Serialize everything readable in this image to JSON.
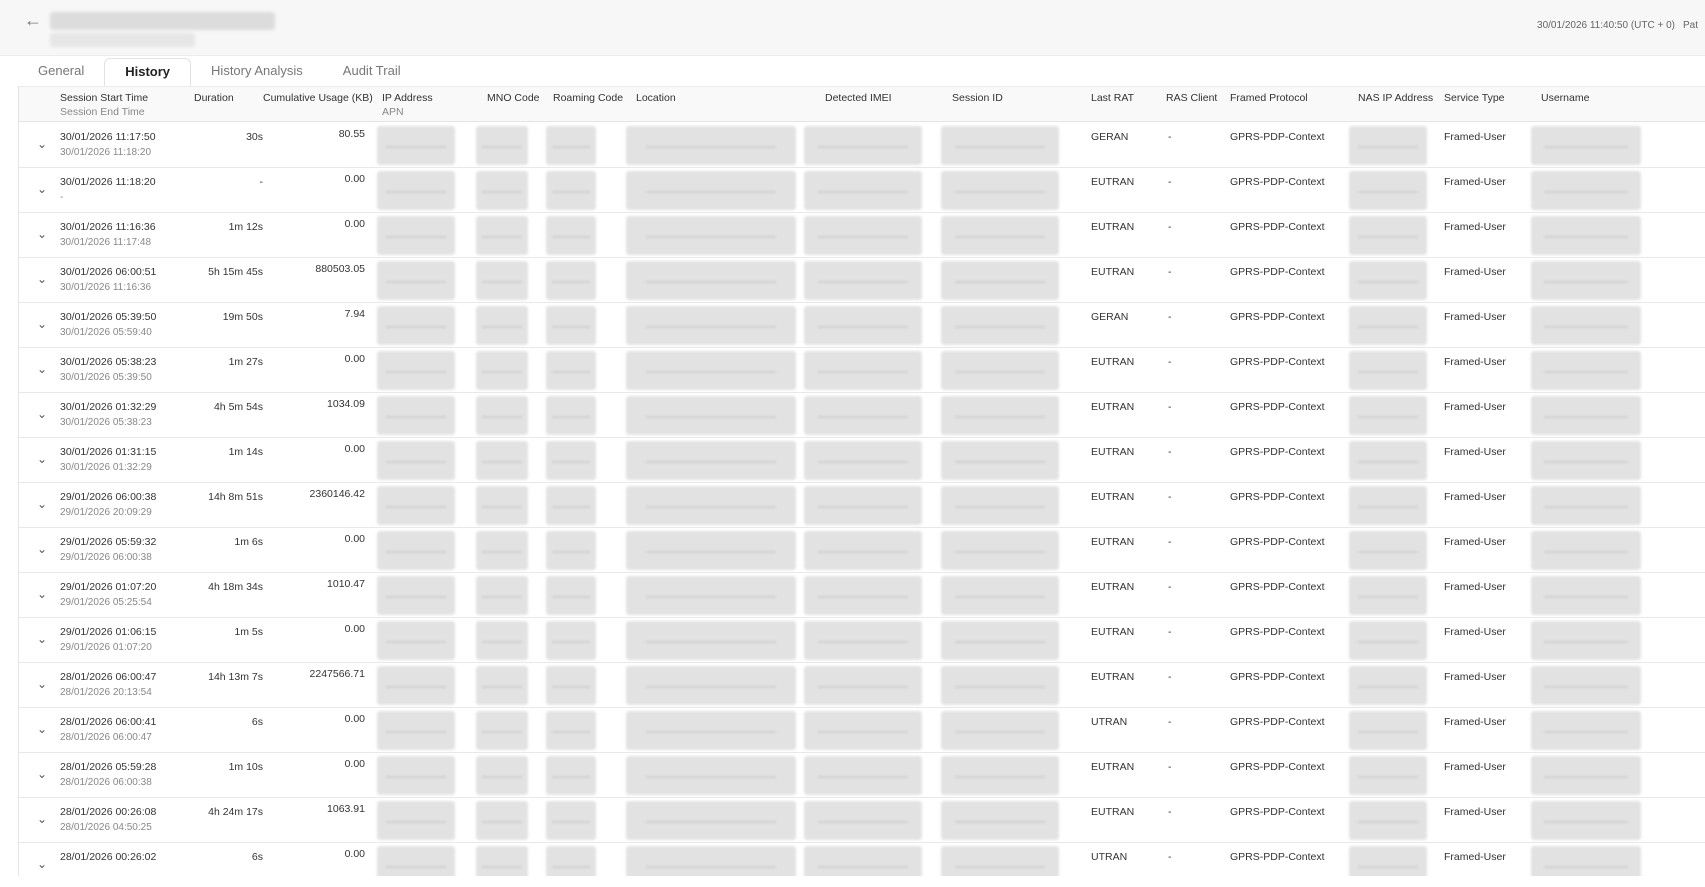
{
  "header": {
    "back_icon": "arrow-left-icon",
    "timestamp": "30/01/2026 11:40:50 (UTC + 0)",
    "timestamp_tail": "Pat"
  },
  "tabs": [
    {
      "label": "General",
      "active": false
    },
    {
      "label": "History",
      "active": true
    },
    {
      "label": "History Analysis",
      "active": false
    },
    {
      "label": "Audit Trail",
      "active": false
    }
  ],
  "columns": {
    "session_start": "Session Start Time",
    "session_end": "Session End Time",
    "duration": "Duration",
    "usage": "Cumulative Usage (KB)",
    "ip": "IP Address",
    "apn": "APN",
    "mno": "MNO Code",
    "roaming": "Roaming Code",
    "location": "Location",
    "imei": "Detected IMEI",
    "session_id": "Session ID",
    "last_rat": "Last RAT",
    "ras_client": "RAS Client",
    "framed_protocol": "Framed Protocol",
    "nas_ip": "NAS IP Address",
    "service_type": "Service Type",
    "username": "Username"
  },
  "rows": [
    {
      "start": "30/01/2026 11:17:50",
      "end": "30/01/2026 11:18:20",
      "duration": "30s",
      "usage": "80.55",
      "rat": "GERAN",
      "ras": "-",
      "protocol": "GPRS-PDP-Context",
      "service": "Framed-User"
    },
    {
      "start": "30/01/2026 11:18:20",
      "end": "-",
      "duration": "-",
      "usage": "0.00",
      "rat": "EUTRAN",
      "ras": "-",
      "protocol": "GPRS-PDP-Context",
      "service": "Framed-User"
    },
    {
      "start": "30/01/2026 11:16:36",
      "end": "30/01/2026 11:17:48",
      "duration": "1m 12s",
      "usage": "0.00",
      "rat": "EUTRAN",
      "ras": "-",
      "protocol": "GPRS-PDP-Context",
      "service": "Framed-User"
    },
    {
      "start": "30/01/2026 06:00:51",
      "end": "30/01/2026 11:16:36",
      "duration": "5h 15m 45s",
      "usage": "880503.05",
      "rat": "EUTRAN",
      "ras": "-",
      "protocol": "GPRS-PDP-Context",
      "service": "Framed-User"
    },
    {
      "start": "30/01/2026 05:39:50",
      "end": "30/01/2026 05:59:40",
      "duration": "19m 50s",
      "usage": "7.94",
      "rat": "GERAN",
      "ras": "-",
      "protocol": "GPRS-PDP-Context",
      "service": "Framed-User"
    },
    {
      "start": "30/01/2026 05:38:23",
      "end": "30/01/2026 05:39:50",
      "duration": "1m 27s",
      "usage": "0.00",
      "rat": "EUTRAN",
      "ras": "-",
      "protocol": "GPRS-PDP-Context",
      "service": "Framed-User"
    },
    {
      "start": "30/01/2026 01:32:29",
      "end": "30/01/2026 05:38:23",
      "duration": "4h 5m 54s",
      "usage": "1034.09",
      "rat": "EUTRAN",
      "ras": "-",
      "protocol": "GPRS-PDP-Context",
      "service": "Framed-User"
    },
    {
      "start": "30/01/2026 01:31:15",
      "end": "30/01/2026 01:32:29",
      "duration": "1m 14s",
      "usage": "0.00",
      "rat": "EUTRAN",
      "ras": "-",
      "protocol": "GPRS-PDP-Context",
      "service": "Framed-User"
    },
    {
      "start": "29/01/2026 06:00:38",
      "end": "29/01/2026 20:09:29",
      "duration": "14h 8m 51s",
      "usage": "2360146.42",
      "rat": "EUTRAN",
      "ras": "-",
      "protocol": "GPRS-PDP-Context",
      "service": "Framed-User"
    },
    {
      "start": "29/01/2026 05:59:32",
      "end": "29/01/2026 06:00:38",
      "duration": "1m 6s",
      "usage": "0.00",
      "rat": "EUTRAN",
      "ras": "-",
      "protocol": "GPRS-PDP-Context",
      "service": "Framed-User"
    },
    {
      "start": "29/01/2026 01:07:20",
      "end": "29/01/2026 05:25:54",
      "duration": "4h 18m 34s",
      "usage": "1010.47",
      "rat": "EUTRAN",
      "ras": "-",
      "protocol": "GPRS-PDP-Context",
      "service": "Framed-User"
    },
    {
      "start": "29/01/2026 01:06:15",
      "end": "29/01/2026 01:07:20",
      "duration": "1m 5s",
      "usage": "0.00",
      "rat": "EUTRAN",
      "ras": "-",
      "protocol": "GPRS-PDP-Context",
      "service": "Framed-User"
    },
    {
      "start": "28/01/2026 06:00:47",
      "end": "28/01/2026 20:13:54",
      "duration": "14h 13m 7s",
      "usage": "2247566.71",
      "rat": "EUTRAN",
      "ras": "-",
      "protocol": "GPRS-PDP-Context",
      "service": "Framed-User"
    },
    {
      "start": "28/01/2026 06:00:41",
      "end": "28/01/2026 06:00:47",
      "duration": "6s",
      "usage": "0.00",
      "rat": "UTRAN",
      "ras": "-",
      "protocol": "GPRS-PDP-Context",
      "service": "Framed-User"
    },
    {
      "start": "28/01/2026 05:59:28",
      "end": "28/01/2026 06:00:38",
      "duration": "1m 10s",
      "usage": "0.00",
      "rat": "EUTRAN",
      "ras": "-",
      "protocol": "GPRS-PDP-Context",
      "service": "Framed-User"
    },
    {
      "start": "28/01/2026 00:26:08",
      "end": "28/01/2026 04:50:25",
      "duration": "4h 24m 17s",
      "usage": "1063.91",
      "rat": "EUTRAN",
      "ras": "-",
      "protocol": "GPRS-PDP-Context",
      "service": "Framed-User"
    },
    {
      "start": "28/01/2026 00:26:02",
      "end": "",
      "duration": "6s",
      "usage": "0.00",
      "rat": "UTRAN",
      "ras": "-",
      "protocol": "GPRS-PDP-Context",
      "service": "Framed-User"
    }
  ],
  "row_expand_icon": "chevron-down-icon"
}
